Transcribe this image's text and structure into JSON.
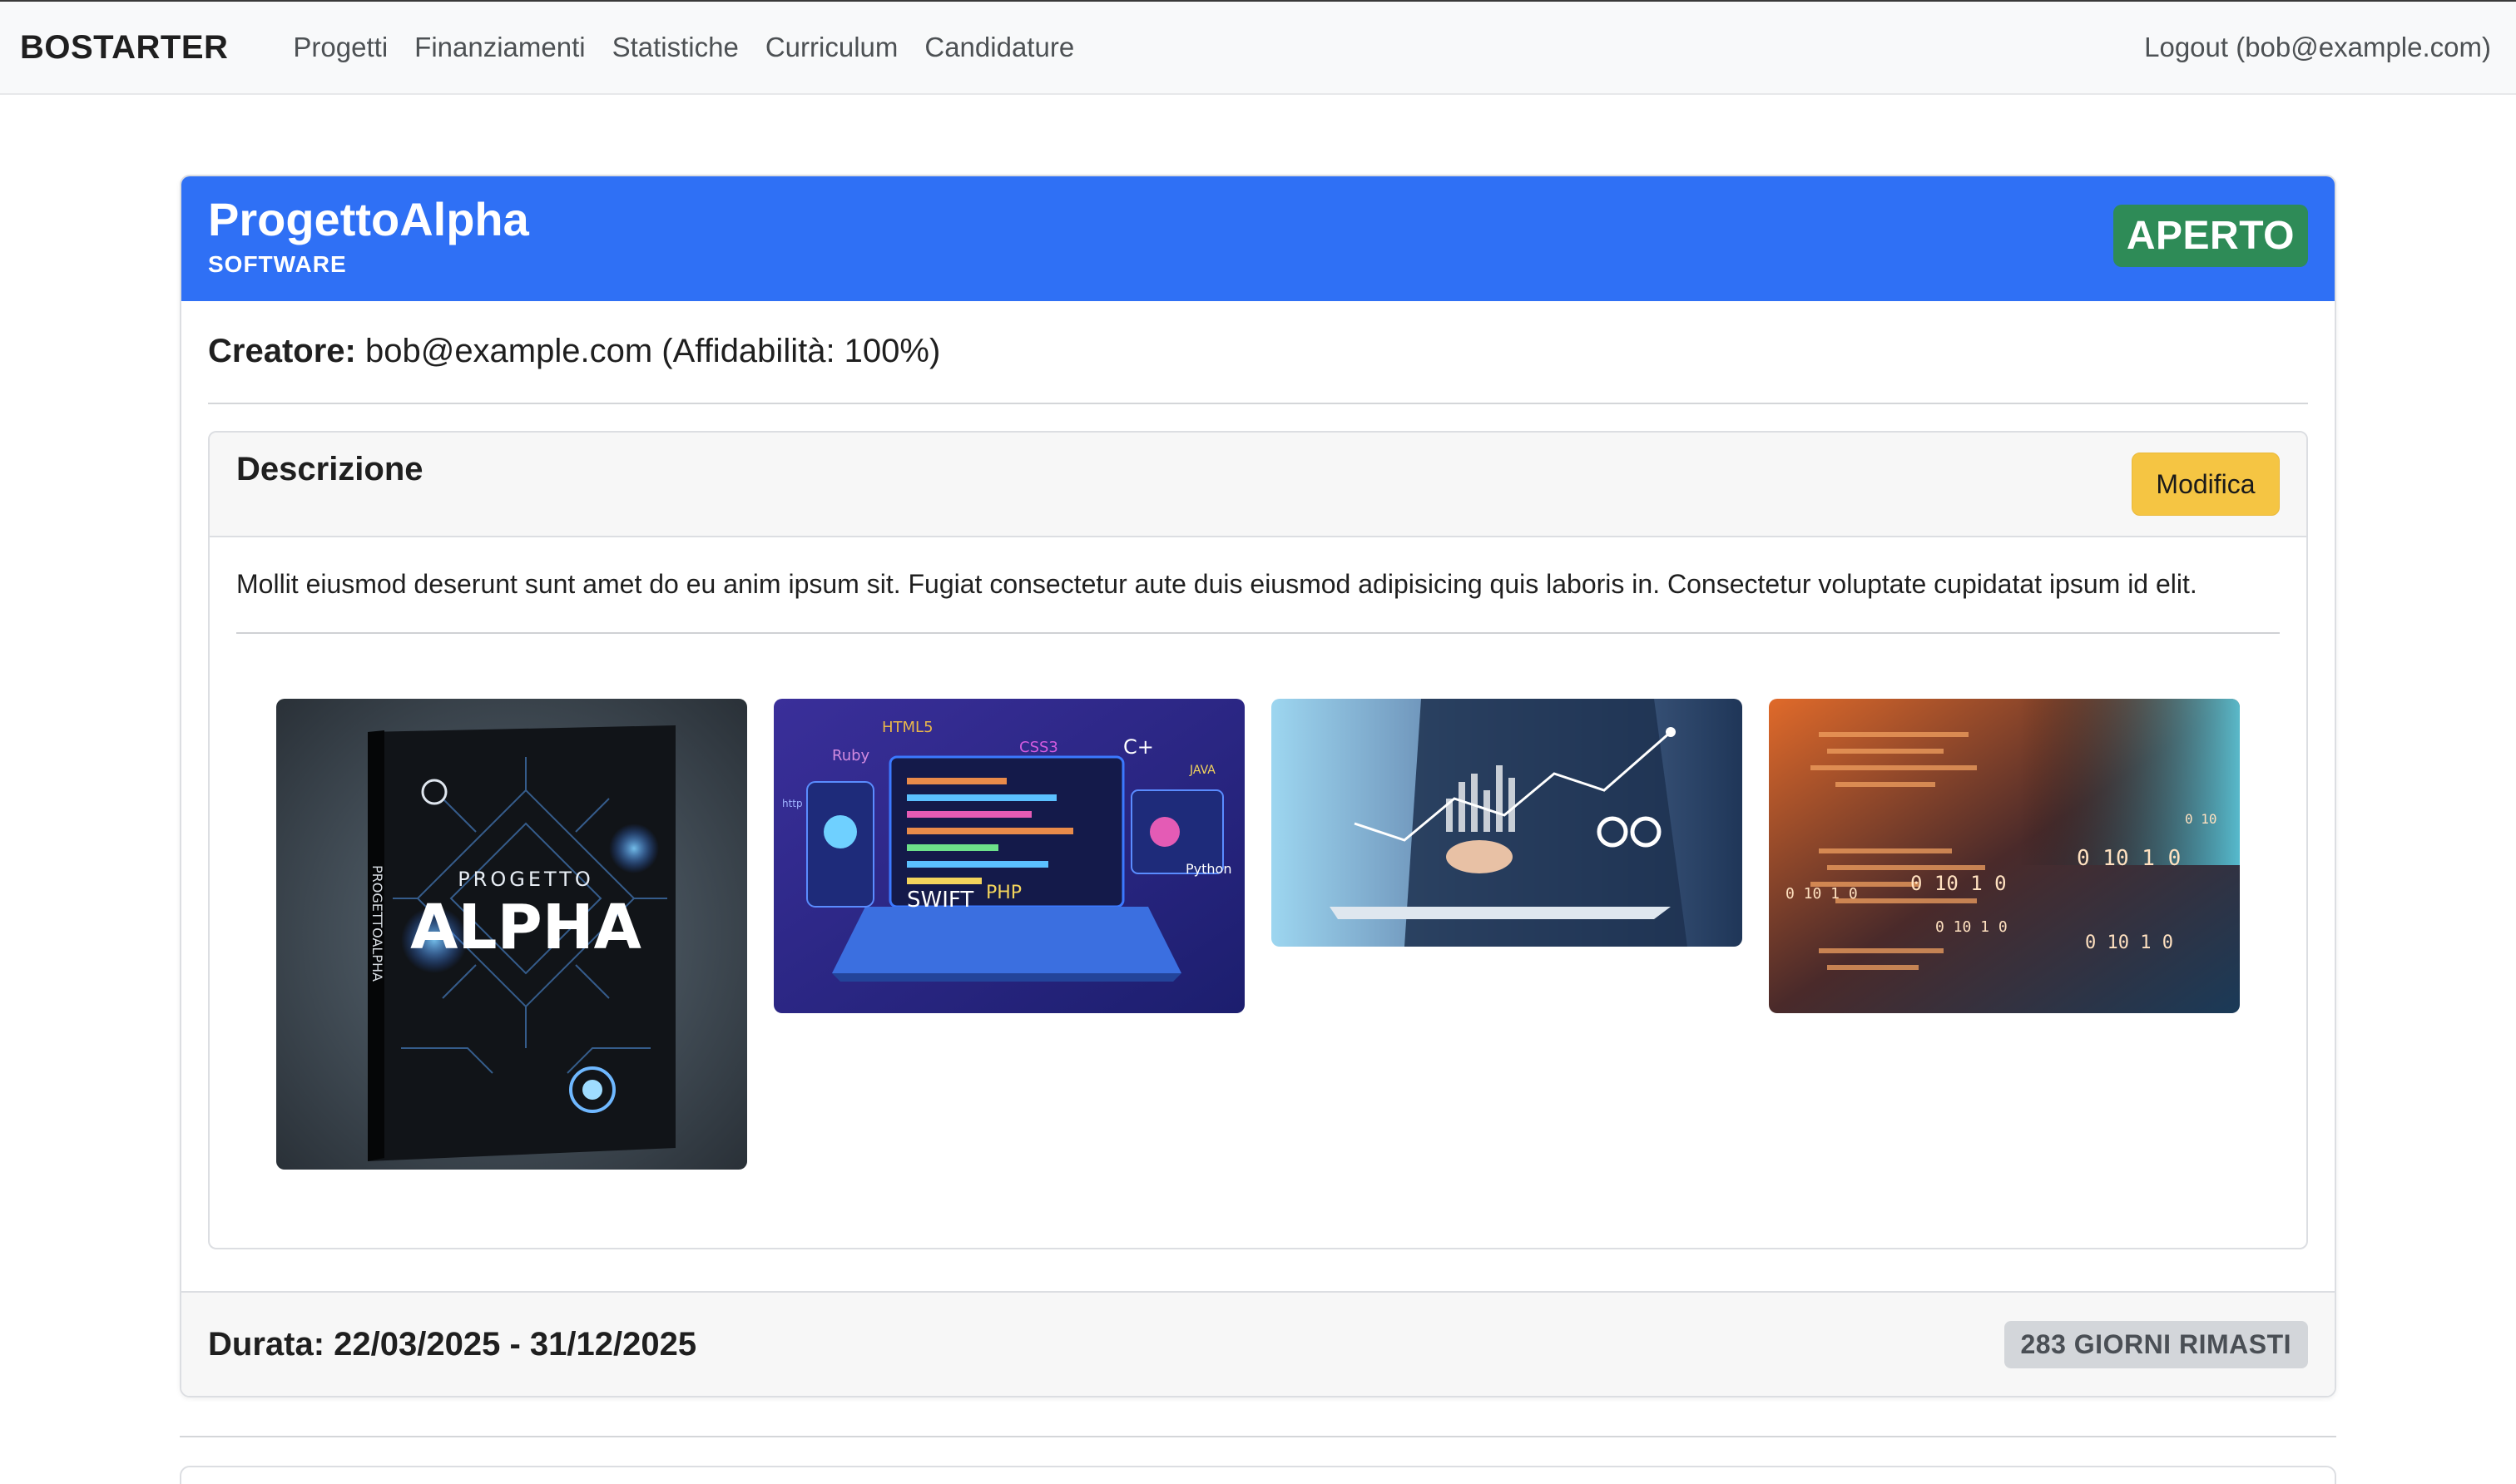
{
  "navbar": {
    "brand": "BOSTARTER",
    "links": [
      "Progetti",
      "Finanziamenti",
      "Statistiche",
      "Curriculum",
      "Candidature"
    ],
    "logout": "Logout (bob@example.com)"
  },
  "project": {
    "title": "ProgettoAlpha",
    "category": "SOFTWARE",
    "status": "APERTO",
    "creator_label": "Creatore:",
    "creator_value": "bob@example.com (Affidabilità: 100%)",
    "description_title": "Descrizione",
    "edit_label": "Modifica",
    "description": "Mollit eiusmod deserunt sunt amet do eu anim ipsum sit. Fugiat consectetur aute duis eiusmod adipisicing quis laboris in. Consectetur voluptate cupidatat ipsum id elit.",
    "duration": "Durata: 22/03/2025 - 31/12/2025",
    "days_left": "283 GIORNI RIMASTI"
  },
  "images": {
    "cover_small": "PROGETTO",
    "cover_big": "ALPHA",
    "cover_spine": "PROGETTOALPHA",
    "code_tags": [
      "HTML5",
      "CSS3",
      "C+",
      "Ruby",
      "JAVA",
      "SWIFT",
      "PHP",
      "Python",
      "http"
    ],
    "binary_tags": [
      "0 10 1 0",
      "0 10 1 0",
      "0 10 1 0",
      "0 10 1 0",
      "0 10 1 0",
      "0 10"
    ]
  },
  "colors": {
    "header_blue": "#2f70f5",
    "status_green": "#2e8b57",
    "edit_yellow": "#f5c543",
    "badge_grey": "#d3d6da"
  }
}
